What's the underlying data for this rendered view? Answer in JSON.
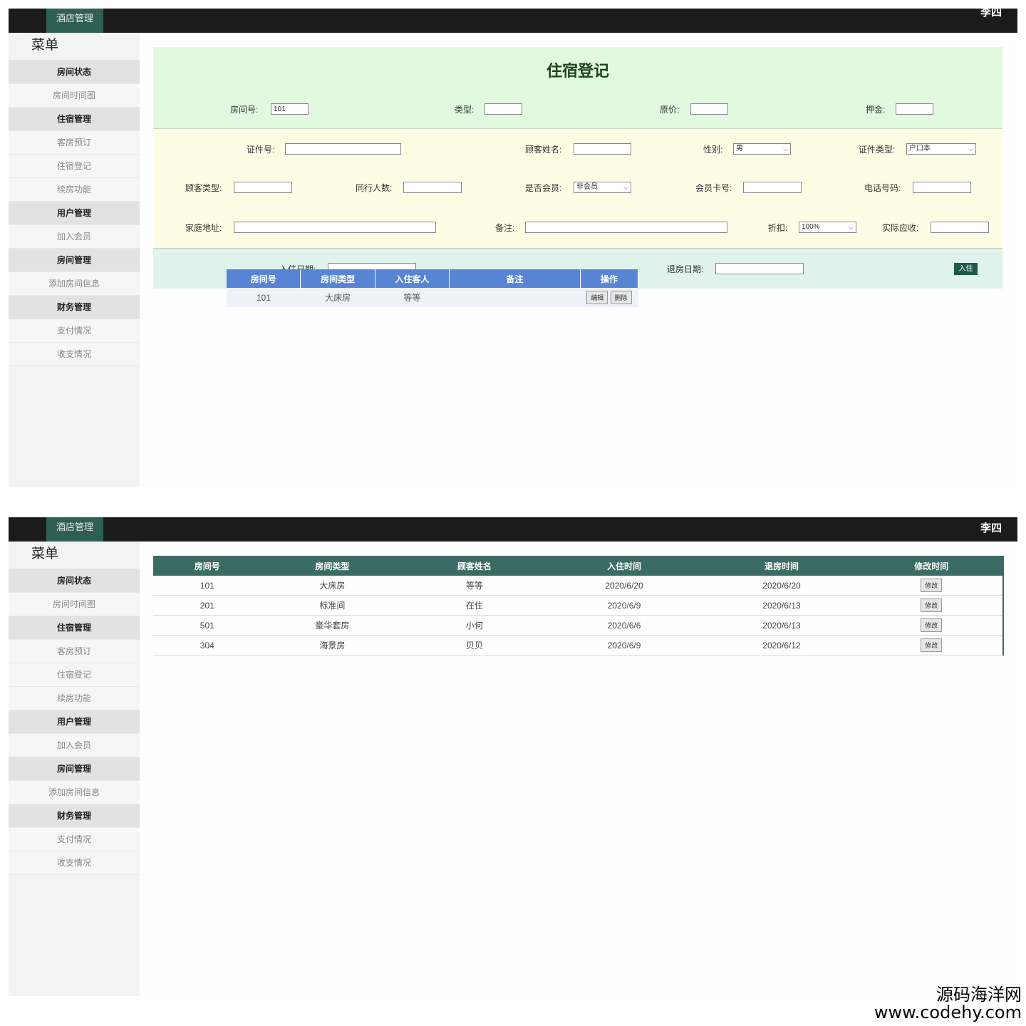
{
  "header": {
    "brand": "酒店管理",
    "user": "李四"
  },
  "sidebar": {
    "title": "菜单",
    "items": [
      {
        "label": "房间状态",
        "group": true
      },
      {
        "label": "房间时间图",
        "group": false
      },
      {
        "label": "住宿管理",
        "group": true
      },
      {
        "label": "客房预订",
        "group": false
      },
      {
        "label": "住宿登记",
        "group": false
      },
      {
        "label": "续房功能",
        "group": false
      },
      {
        "label": "用户管理",
        "group": true
      },
      {
        "label": "加入会员",
        "group": false
      },
      {
        "label": "房间管理",
        "group": true
      },
      {
        "label": "添加房间信息",
        "group": false
      },
      {
        "label": "财务管理",
        "group": true
      },
      {
        "label": "支付情况",
        "group": false
      },
      {
        "label": "收支情况",
        "group": false
      }
    ]
  },
  "checkin_form": {
    "title": "住宿登记",
    "room_no_label": "房间号:",
    "room_no_value": "101",
    "type_label": "类型:",
    "price_label": "原价:",
    "deposit_label": "押金:",
    "id_no_label": "证件号:",
    "guest_name_label": "顾客姓名:",
    "gender_label": "性别:",
    "gender_value": "男",
    "id_type_label": "证件类型:",
    "id_type_value": "户口本",
    "guest_type_label": "顾客类型:",
    "companions_label": "同行人数:",
    "member_label": "是否会员:",
    "member_value": "非会员",
    "card_no_label": "会员卡号:",
    "phone_label": "电话号码:",
    "address_label": "家庭地址:",
    "remark_label": "备注:",
    "discount_label": "折扣:",
    "discount_value": "100%",
    "actual_label": "实际应收:",
    "checkin_date_label": "入住日期:",
    "checkout_date_label": "退房日期:",
    "submit_label": "入住"
  },
  "guest_table": {
    "headers": [
      "房间号",
      "房间类型",
      "入住客人",
      "备注",
      "操作"
    ],
    "rows": [
      {
        "room": "101",
        "type": "大床房",
        "guest": "等等",
        "remark": "",
        "edit": "编辑",
        "delete": "删除"
      }
    ]
  },
  "records_table": {
    "headers": [
      "房间号",
      "房间类型",
      "顾客姓名",
      "入住时间",
      "退房时间",
      "修改时间"
    ],
    "modify_label": "修改",
    "rows": [
      {
        "room": "101",
        "type": "大床房",
        "name": "等等",
        "in": "2020/6/20",
        "out": "2020/6/20"
      },
      {
        "room": "201",
        "type": "标准间",
        "name": "在住",
        "in": "2020/6/9",
        "out": "2020/6/13"
      },
      {
        "room": "501",
        "type": "豪华套房",
        "name": "小何",
        "in": "2020/6/6",
        "out": "2020/6/13"
      },
      {
        "room": "304",
        "type": "海景房",
        "name": "贝贝",
        "in": "2020/6/9",
        "out": "2020/6/12"
      }
    ]
  },
  "watermark": {
    "line1": "源码海洋网",
    "line2": "www.codehy.com"
  }
}
